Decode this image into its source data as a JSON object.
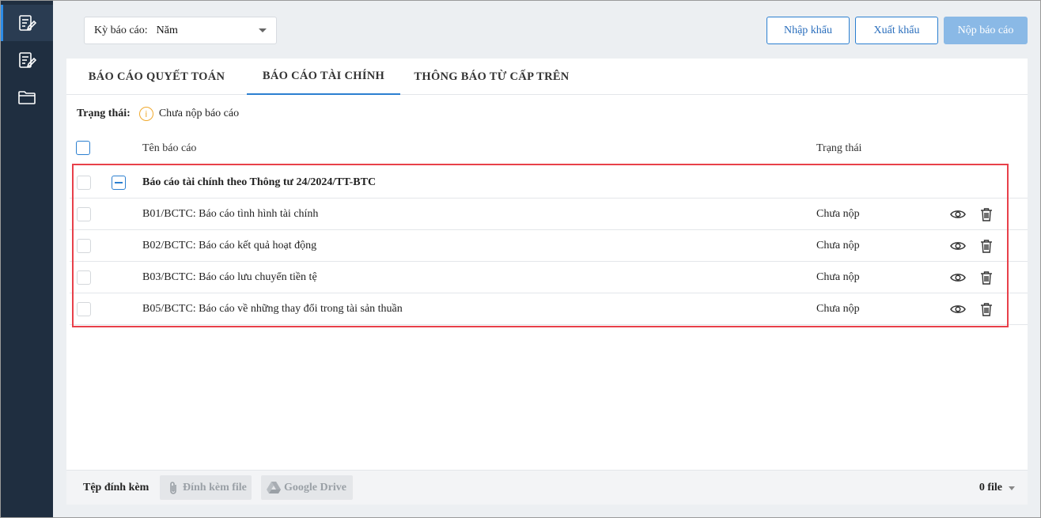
{
  "sidebar": {
    "items": [
      {
        "icon": "report-edit-icon",
        "active": true
      },
      {
        "icon": "document-edit-icon",
        "active": false
      },
      {
        "icon": "folder-icon",
        "active": false
      }
    ]
  },
  "topbar": {
    "period_label": "Kỳ báo cáo:",
    "period_value": "Năm",
    "import_label": "Nhập khẩu",
    "export_label": "Xuất khẩu",
    "submit_label": "Nộp báo cáo"
  },
  "tabs": [
    {
      "label": "BÁO CÁO QUYẾT TOÁN",
      "active": false
    },
    {
      "label": "BÁO CÁO TÀI CHÍNH",
      "active": true
    },
    {
      "label": "THÔNG BÁO TỪ CẤP TRÊN",
      "active": false
    }
  ],
  "status": {
    "label": "Trạng thái:",
    "icon": "info-icon",
    "value": "Chưa nộp báo cáo"
  },
  "table": {
    "headers": {
      "name": "Tên báo cáo",
      "status": "Trạng thái"
    },
    "group": {
      "name": "Báo cáo tài chính theo Thông tư 24/2024/TT-BTC"
    },
    "rows": [
      {
        "name": "B01/BCTC: Báo cáo tình hình tài chính",
        "status": "Chưa nộp"
      },
      {
        "name": "B02/BCTC: Báo cáo kết quả hoạt động",
        "status": "Chưa nộp"
      },
      {
        "name": "B03/BCTC: Báo cáo lưu chuyển tiền tệ",
        "status": "Chưa nộp"
      },
      {
        "name": "B05/BCTC: Báo cáo về những thay đổi trong tài sản thuần",
        "status": "Chưa nộp"
      }
    ]
  },
  "footer": {
    "label": "Tệp đính kèm",
    "attach_label": "Đính kèm file",
    "drive_label": "Google Drive",
    "file_count": "0 file"
  },
  "colors": {
    "sidebar": "#1f2e40",
    "accent": "#2b7fd0",
    "highlight": "#e8404a",
    "warning": "#f0a92e"
  }
}
